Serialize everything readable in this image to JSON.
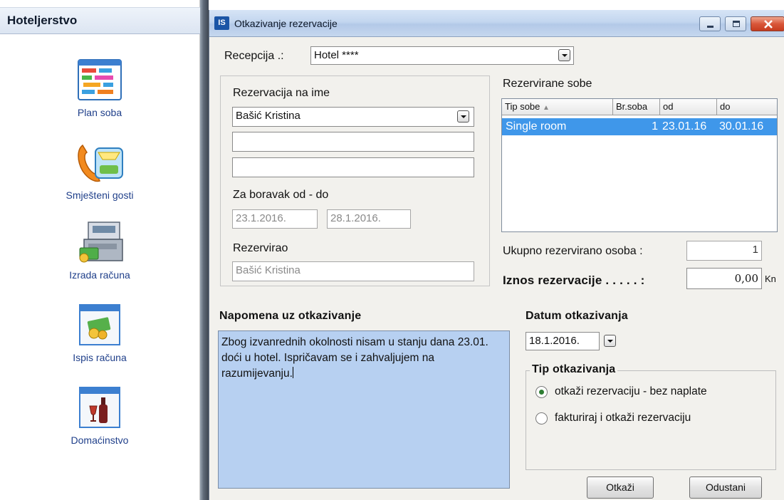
{
  "sidebar": {
    "title": "Hoteljerstvo",
    "items": [
      {
        "label": "Plan soba",
        "icon": "room-plan-icon"
      },
      {
        "label": "Smješteni gosti",
        "icon": "telephone-icon"
      },
      {
        "label": "Izrada računa",
        "icon": "cash-register-icon"
      },
      {
        "label": "Ispis računa",
        "icon": "invoice-money-icon"
      },
      {
        "label": "Domaćinstvo",
        "icon": "wine-icon"
      }
    ]
  },
  "dialog": {
    "app_badge": "IS",
    "title": "Otkazivanje rezervacije",
    "reception": {
      "label": "Recepcija .:",
      "value": "Hotel ****"
    },
    "reservation_name": {
      "label": "Rezervacija na ime",
      "value": "Bašić Kristina",
      "extra1": "",
      "extra2": ""
    },
    "stay": {
      "label": "Za boravak od - do",
      "from": "23.1.2016.",
      "to": "28.1.2016."
    },
    "reserved_by": {
      "label": "Rezervirao",
      "value": "Bašić Kristina"
    },
    "rooms": {
      "label": "Rezervirane sobe",
      "columns": [
        "Tip sobe",
        "Br.soba",
        "od",
        "do"
      ],
      "rows": [
        {
          "type": "Single room",
          "count": "1",
          "from": "23.01.16",
          "to": "30.01.16"
        }
      ]
    },
    "total_persons": {
      "label": "Ukupno rezervirano osoba :",
      "value": "1"
    },
    "amount": {
      "label": "Iznos rezervacije . . . . . :",
      "value": "0,00",
      "currency": "Kn"
    },
    "note": {
      "label": "Napomena uz otkazivanje",
      "text": "Zbog izvanrednih okolnosti nisam u stanju dana 23.01. doći u hotel. Ispričavam se i zahvaljujem na razumijevanju."
    },
    "cancel_date": {
      "label": "Datum otkazivanja",
      "value": "18.1.2016."
    },
    "cancel_type": {
      "label": "Tip otkazivanja",
      "options": [
        {
          "label": "otkaži rezervaciju - bez naplate",
          "checked": true
        },
        {
          "label": "fakturiraj i otkaži rezervaciju",
          "checked": false
        }
      ]
    },
    "buttons": {
      "cancel": "Otkaži",
      "dismiss": "Odustani"
    }
  },
  "colors": {
    "selection": "#3f97ea",
    "note_background": "#b7d0f1",
    "link_blue": "#1f3f8a"
  }
}
